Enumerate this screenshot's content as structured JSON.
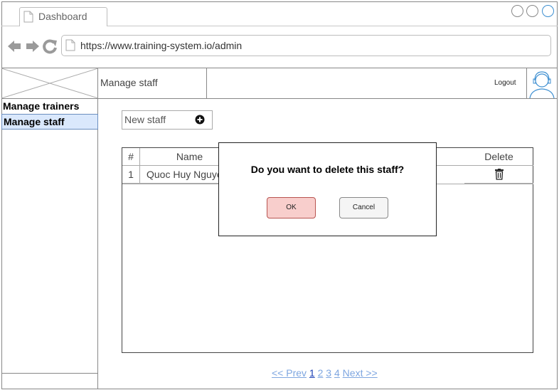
{
  "browser": {
    "tab_title": "Dashboard",
    "url": "https://www.training-system.io/admin"
  },
  "header": {
    "title": "Manage staff",
    "logout_label": "Logout"
  },
  "sidebar": {
    "items": [
      {
        "label": "Manage trainers",
        "active": false
      },
      {
        "label": "Manage staff",
        "active": true
      }
    ]
  },
  "main": {
    "new_staff_label": "New staff",
    "table": {
      "headers": {
        "num": "#",
        "name": "Name",
        "delete": "Delete"
      },
      "rows": [
        {
          "num": "1",
          "name": "Quoc Huy Nguyen"
        }
      ]
    },
    "pagination": {
      "prev": "<< Prev",
      "pages": [
        "1",
        "2",
        "3",
        "4"
      ],
      "current": "1",
      "next": "Next >>"
    }
  },
  "dialog": {
    "message": "Do you want to delete this staff?",
    "ok_label": "OK",
    "cancel_label": "Cancel"
  },
  "colors": {
    "active_sidebar_bg": "#dae8fc",
    "ok_button_bg": "#f8cecc",
    "link_color": "#7ea6e0"
  }
}
